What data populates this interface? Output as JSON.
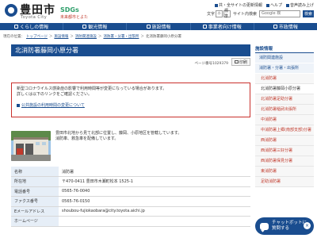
{
  "header": {
    "logo_jp": "豊田市",
    "logo_en": "Toyota City",
    "sdgs_tag": "SDGs未来都市とよた",
    "sdgs_main": "SDGs",
    "sdgs_sub": "未来都市とよた",
    "util_links": [
      "共・全サイトの更新情報",
      "ヘルプ",
      "音声読み上げ"
    ],
    "font_size_label": "文字",
    "font_small": "小",
    "font_standard": "標準",
    "search_label": "サイト内検索",
    "search_placeholder": "Google 検",
    "search_button": "検索"
  },
  "nav": {
    "items": [
      {
        "label": "くらしの情報"
      },
      {
        "label": "観光情報"
      },
      {
        "label": "施設情報"
      },
      {
        "label": "事業者向け情報"
      },
      {
        "label": "市政情報"
      }
    ]
  },
  "breadcrumb": {
    "current_prefix": "現在の位置：",
    "items": [
      "トップページ",
      "施設情報",
      "消防関連施設",
      "消防署・分署・出張所"
    ],
    "current": "北消防署藤岡小原分署"
  },
  "main": {
    "title": "北消防署藤岡小原分署",
    "page_id": "ページ番号1029379",
    "print_label": "印刷",
    "notice_lines": [
      "新型コロナウイルス感染症の影響で利用時間等が変更になっている場合があります。",
      "詳しくは以下のリンクをご確認ください。"
    ],
    "notice_link": "公共施設の利用時間の変更について",
    "desc_lines": [
      "豊田市北地から見て北部に位置し、藤岡、小原地区を管轄しています。",
      "消防車、救急車を配備しています。"
    ]
  },
  "info_table": [
    {
      "label": "名称",
      "value": "消防署"
    },
    {
      "label": "所在地",
      "value": "〒470-0411 豊田市木瀬町松本 1525-1"
    },
    {
      "label": "電話番号",
      "value": "0565-76-0040"
    },
    {
      "label": "ファクス番号",
      "value": "0565-76-0150"
    },
    {
      "label": "Eメールアドレス",
      "value": "shoubou-fujiokaobara@city.toyota.aichi.jp"
    },
    {
      "label": "ホームページ",
      "value": ""
    }
  ],
  "side": {
    "title": "施設情報",
    "items": [
      {
        "label": "消防関連施設",
        "type": "main"
      },
      {
        "label": "消防署・分署・出張所",
        "type": "main"
      },
      {
        "label": "北消防署",
        "type": "sub"
      },
      {
        "label": "北消防署藤岡小原分署",
        "type": "active"
      },
      {
        "label": "北消防署足助分署",
        "type": "sub"
      },
      {
        "label": "北消防署稲武出張所",
        "type": "sub"
      },
      {
        "label": "中消防署",
        "type": "sub"
      },
      {
        "label": "中消防署上郷(南部支部)分署",
        "type": "sub"
      },
      {
        "label": "西消防署",
        "type": "sub"
      },
      {
        "label": "西消防署三好分署",
        "type": "sub"
      },
      {
        "label": "西消防署保見分署",
        "type": "sub"
      },
      {
        "label": "東消防署",
        "type": "sub"
      },
      {
        "label": "足助消防署",
        "type": "sub"
      }
    ]
  },
  "chatbot": {
    "line1": "チャットボットに",
    "line2": "質問する",
    "close": "×"
  },
  "colors": {
    "brand_blue": "#1a4d8f",
    "notice_red": "#c9302c"
  }
}
